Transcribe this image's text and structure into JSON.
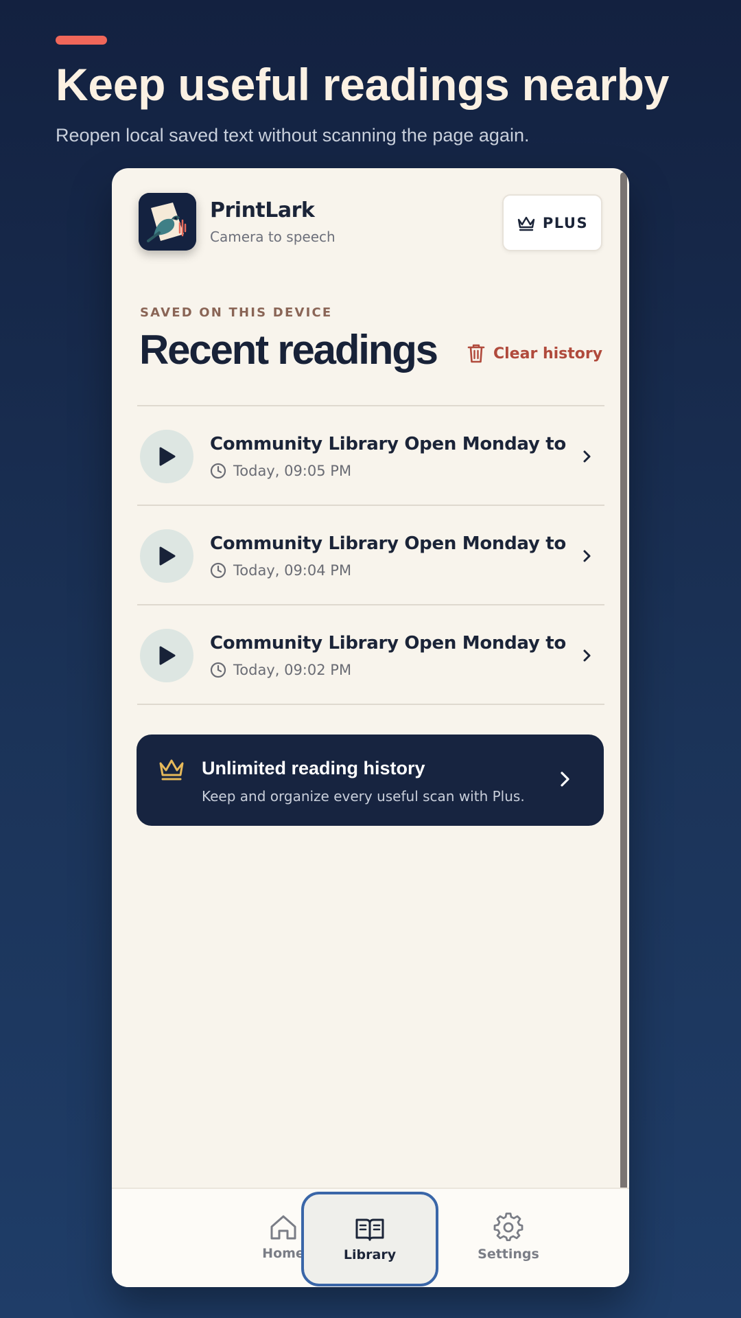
{
  "hero": {
    "title": "Keep useful readings nearby",
    "subtitle": "Reopen local saved text without scanning the page again."
  },
  "app": {
    "name": "PrintLark",
    "tagline": "Camera to speech",
    "logo_icon": "bird-with-sound-waves-logo",
    "plus_label": "PLUS"
  },
  "section": {
    "eyebrow": "SAVED ON THIS DEVICE",
    "title": "Recent readings",
    "clear_label": "Clear history"
  },
  "readings": [
    {
      "title": "Community Library Open Monday to...",
      "time": "Today, 09:05 PM"
    },
    {
      "title": "Community Library Open Monday to...",
      "time": "Today, 09:04 PM"
    },
    {
      "title": "Community Library Open Monday to...",
      "time": "Today, 09:02 PM"
    }
  ],
  "promo": {
    "title": "Unlimited reading history",
    "subtitle": "Keep and organize every useful scan with Plus."
  },
  "tabs": [
    {
      "label": "Home",
      "icon": "home-icon"
    },
    {
      "label": "Library",
      "icon": "book-open-icon",
      "active": true
    },
    {
      "label": "Settings",
      "icon": "gear-icon"
    }
  ],
  "colors": {
    "accent": "#f0675a",
    "navy": "#172440",
    "danger": "#b04a3c",
    "gold": "#e6b95a",
    "active_ring": "#3a66a8"
  }
}
